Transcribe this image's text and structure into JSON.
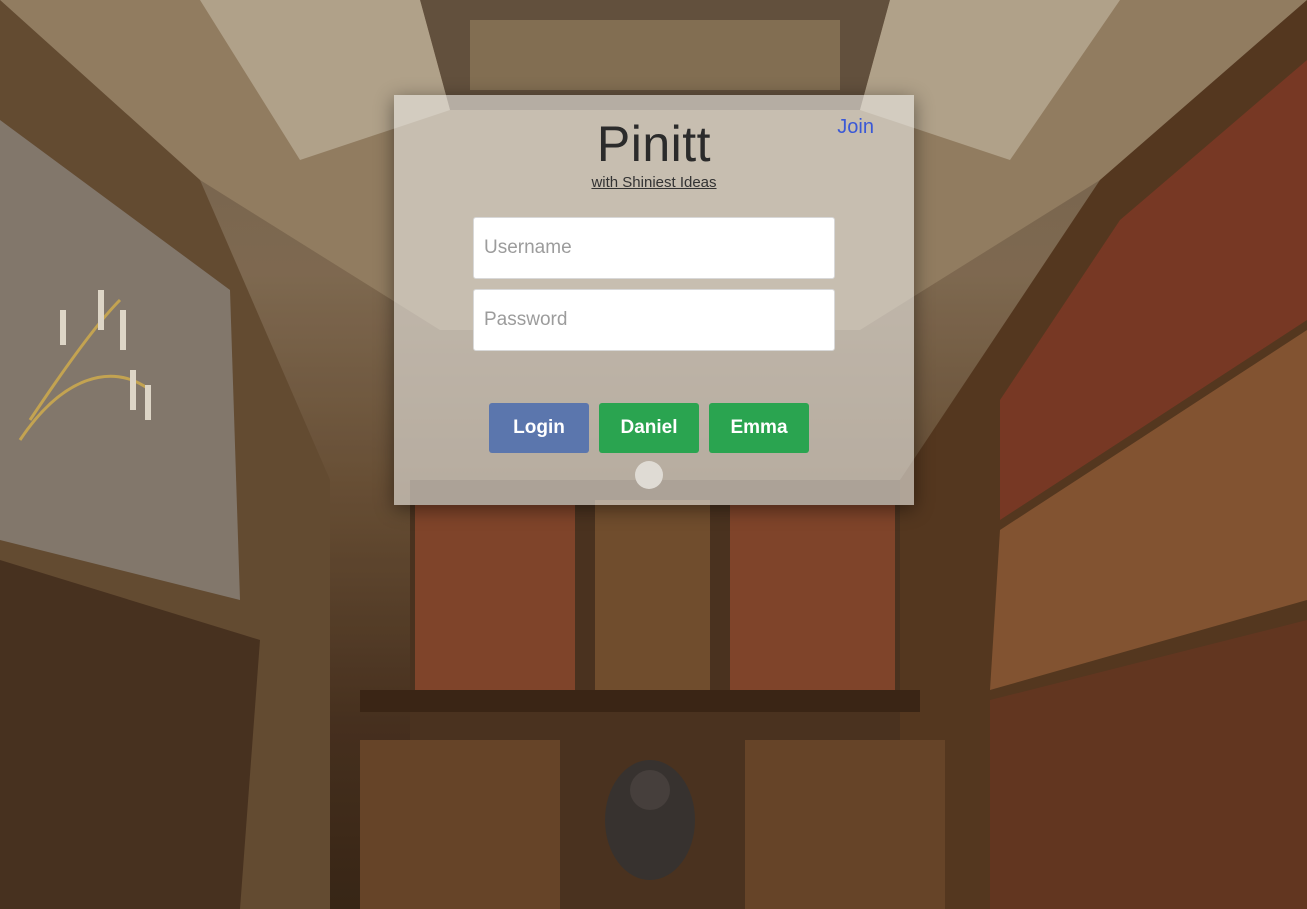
{
  "app": {
    "title": "Pinitt",
    "subtitle": "with Shiniest Ideas",
    "join_label": "Join"
  },
  "form": {
    "username_placeholder": "Username",
    "password_placeholder": "Password",
    "username_value": "",
    "password_value": ""
  },
  "buttons": {
    "login_label": "Login",
    "daniel_label": "Daniel",
    "emma_label": "Emma"
  },
  "colors": {
    "login": "#5b76ad",
    "demo_user": "#2aa450",
    "join_link": "#3a58d6"
  },
  "background": {
    "description_icon": "library-photo"
  }
}
